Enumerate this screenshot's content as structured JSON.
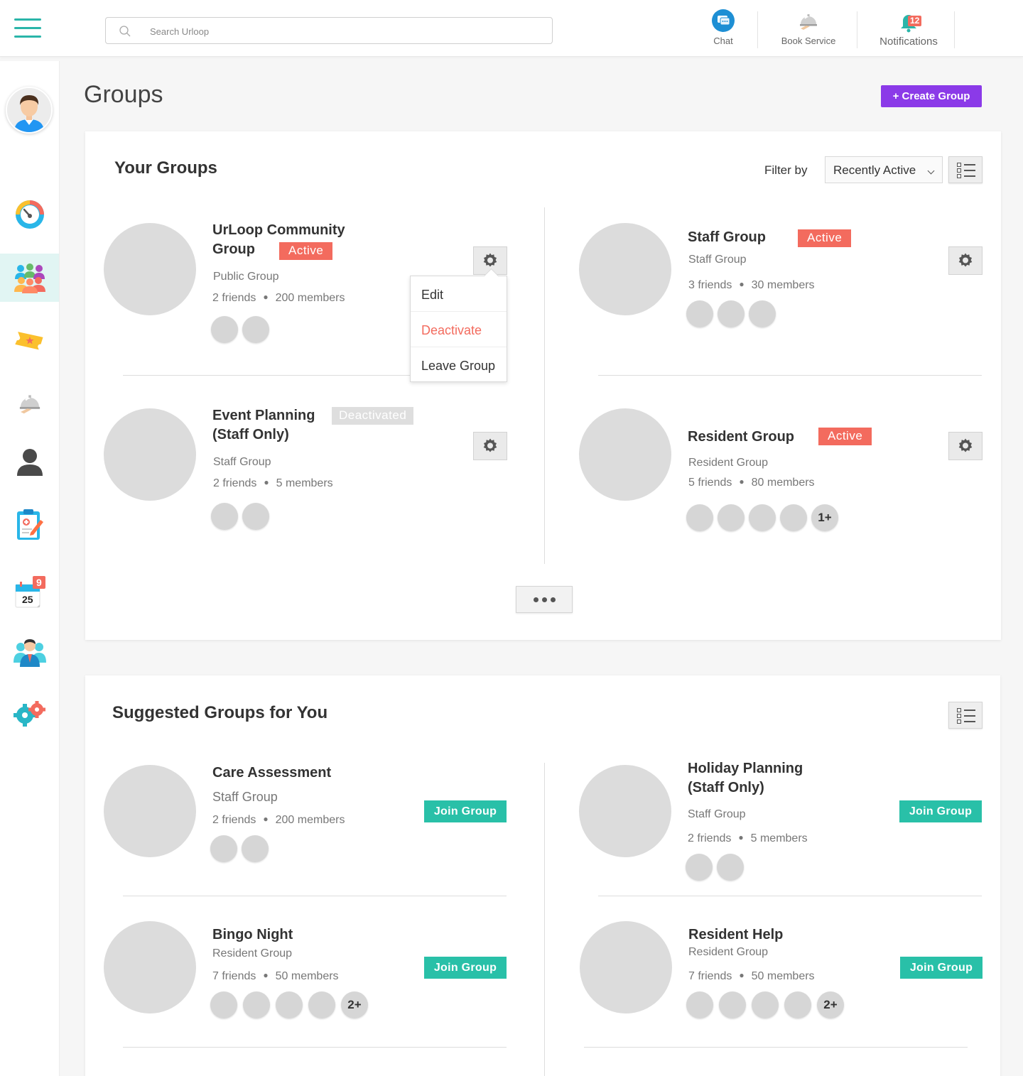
{
  "header": {
    "search_placeholder": "Search Urloop",
    "nav": [
      {
        "label": "Chat",
        "icon": "chat-icon"
      },
      {
        "label": "Book Service",
        "icon": "service-bell-icon"
      },
      {
        "label": "Notifications",
        "icon": "bell-icon",
        "badge": "12"
      }
    ]
  },
  "sidebar": {
    "calendar_badge": "9",
    "calendar_day": "25"
  },
  "page": {
    "title": "Groups",
    "create_label": "+ Create Group"
  },
  "your_groups": {
    "title": "Your Groups",
    "filter_label": "Filter by",
    "filter_value": "Recently Active",
    "menu": [
      "Edit",
      "Deactivate",
      "Leave Group"
    ],
    "groups": [
      {
        "name_l1": "UrLoop Community",
        "name_l2": "Group",
        "status": "Active",
        "type": "Public Group",
        "friends": "2 friends",
        "members": "200 members"
      },
      {
        "name_l1": "Staff Group",
        "status": "Active",
        "type": "Staff Group",
        "friends": "3 friends",
        "members": "30 members"
      },
      {
        "name_l1": "Event Planning",
        "name_l2": "(Staff Only)",
        "status": "Deactivated",
        "type": "Staff Group",
        "friends": "2 friends",
        "members": "5 members"
      },
      {
        "name_l1": "Resident Group",
        "status": "Active",
        "type": "Resident Group",
        "friends": "5 friends",
        "members": "80 members",
        "more": "1+"
      }
    ]
  },
  "suggested": {
    "title": "Suggested Groups for You",
    "join_label": "Join Group",
    "groups": [
      {
        "name_l1": "Care Assessment",
        "type": "Staff Group",
        "friends": "2 friends",
        "members": "200 members"
      },
      {
        "name_l1": "Holiday Planning",
        "name_l2": "(Staff Only)",
        "type": "Staff Group",
        "friends": "2 friends",
        "members": "5 members"
      },
      {
        "name_l1": "Bingo Night",
        "type": "Resident Group",
        "friends": "7 friends",
        "members": "50 members",
        "more": "2+"
      },
      {
        "name_l1": "Resident Help",
        "type": "Resident Group",
        "friends": "7 friends",
        "members": "50 members",
        "more": "2+"
      }
    ]
  },
  "colors": {
    "accent_teal": "#2ab5a9",
    "create_purple": "#8b3ae8",
    "active_red": "#f36b5e",
    "join_green": "#29c0a8"
  }
}
